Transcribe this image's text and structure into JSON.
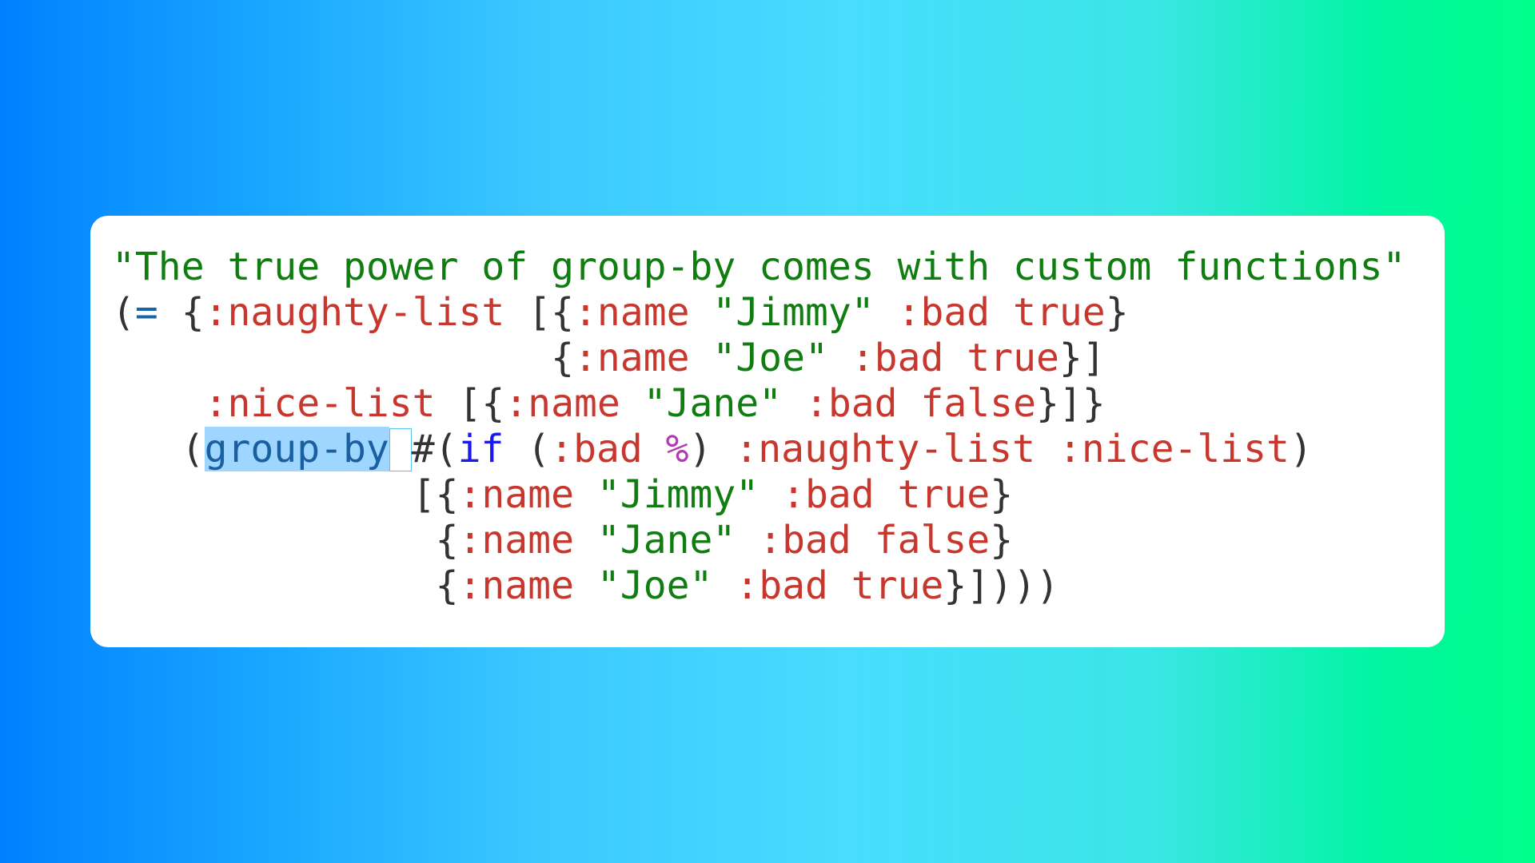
{
  "editor": {
    "lines": [
      [
        {
          "t": "\"The true power of group-by comes with custom functions\"",
          "c": "str"
        }
      ],
      [
        {
          "t": "(",
          "c": "punct"
        },
        {
          "t": "=",
          "c": "sym"
        },
        {
          "t": " {",
          "c": "punct"
        },
        {
          "t": ":naughty-list",
          "c": "kw"
        },
        {
          "t": " [{",
          "c": "punct"
        },
        {
          "t": ":name",
          "c": "kw"
        },
        {
          "t": " ",
          "c": "punct"
        },
        {
          "t": "\"Jimmy\"",
          "c": "str"
        },
        {
          "t": " ",
          "c": "punct"
        },
        {
          "t": ":bad",
          "c": "kw"
        },
        {
          "t": " ",
          "c": "punct"
        },
        {
          "t": "true",
          "c": "kw"
        },
        {
          "t": "}",
          "c": "punct"
        }
      ],
      [
        {
          "t": "                   {",
          "c": "punct"
        },
        {
          "t": ":name",
          "c": "kw"
        },
        {
          "t": " ",
          "c": "punct"
        },
        {
          "t": "\"Joe\"",
          "c": "str"
        },
        {
          "t": " ",
          "c": "punct"
        },
        {
          "t": ":bad",
          "c": "kw"
        },
        {
          "t": " ",
          "c": "punct"
        },
        {
          "t": "true",
          "c": "kw"
        },
        {
          "t": "}]",
          "c": "punct"
        }
      ],
      [
        {
          "t": "    ",
          "c": "punct"
        },
        {
          "t": ":nice-list",
          "c": "kw"
        },
        {
          "t": " [{",
          "c": "punct"
        },
        {
          "t": ":name",
          "c": "kw"
        },
        {
          "t": " ",
          "c": "punct"
        },
        {
          "t": "\"Jane\"",
          "c": "str"
        },
        {
          "t": " ",
          "c": "punct"
        },
        {
          "t": ":bad",
          "c": "kw"
        },
        {
          "t": " ",
          "c": "punct"
        },
        {
          "t": "false",
          "c": "kw"
        },
        {
          "t": "}]}",
          "c": "punct"
        }
      ],
      [
        {
          "t": "   (",
          "c": "punct"
        },
        {
          "t": "group-by",
          "c": "sel"
        },
        {
          "t": "",
          "c": "cursor"
        },
        {
          "t": "#(",
          "c": "punct"
        },
        {
          "t": "if",
          "c": "special"
        },
        {
          "t": " (",
          "c": "punct"
        },
        {
          "t": ":bad",
          "c": "kw"
        },
        {
          "t": " ",
          "c": "punct"
        },
        {
          "t": "%",
          "c": "pct"
        },
        {
          "t": ") ",
          "c": "punct"
        },
        {
          "t": ":naughty-list",
          "c": "kw"
        },
        {
          "t": " ",
          "c": "punct"
        },
        {
          "t": ":nice-list",
          "c": "kw"
        },
        {
          "t": ")",
          "c": "punct"
        }
      ],
      [
        {
          "t": "             [{",
          "c": "punct"
        },
        {
          "t": ":name",
          "c": "kw"
        },
        {
          "t": " ",
          "c": "punct"
        },
        {
          "t": "\"Jimmy\"",
          "c": "str"
        },
        {
          "t": " ",
          "c": "punct"
        },
        {
          "t": ":bad",
          "c": "kw"
        },
        {
          "t": " ",
          "c": "punct"
        },
        {
          "t": "true",
          "c": "kw"
        },
        {
          "t": "}",
          "c": "punct"
        }
      ],
      [
        {
          "t": "              {",
          "c": "punct"
        },
        {
          "t": ":name",
          "c": "kw"
        },
        {
          "t": " ",
          "c": "punct"
        },
        {
          "t": "\"Jane\"",
          "c": "str"
        },
        {
          "t": " ",
          "c": "punct"
        },
        {
          "t": ":bad",
          "c": "kw"
        },
        {
          "t": " ",
          "c": "punct"
        },
        {
          "t": "false",
          "c": "kw"
        },
        {
          "t": "}",
          "c": "punct"
        }
      ],
      [
        {
          "t": "              {",
          "c": "punct"
        },
        {
          "t": ":name",
          "c": "kw"
        },
        {
          "t": " ",
          "c": "punct"
        },
        {
          "t": "\"Joe\"",
          "c": "str"
        },
        {
          "t": " ",
          "c": "punct"
        },
        {
          "t": ":bad",
          "c": "kw"
        },
        {
          "t": " ",
          "c": "punct"
        },
        {
          "t": "true",
          "c": "kw"
        },
        {
          "t": "}])))",
          "c": "punct"
        }
      ]
    ],
    "selection_text": "group-by"
  },
  "colors": {
    "string": "#107d10",
    "keyword": "#c8372d",
    "symbol": "#1565a8",
    "special_form": "#1a1aee",
    "percent": "#b23ab2",
    "punctuation": "#333333",
    "selection_bg": "#9fd6ff",
    "cursor_border": "#54c7ec",
    "card_bg": "#ffffff",
    "gradient": [
      "#0080ff",
      "#48dcff",
      "#00ff8a"
    ]
  }
}
